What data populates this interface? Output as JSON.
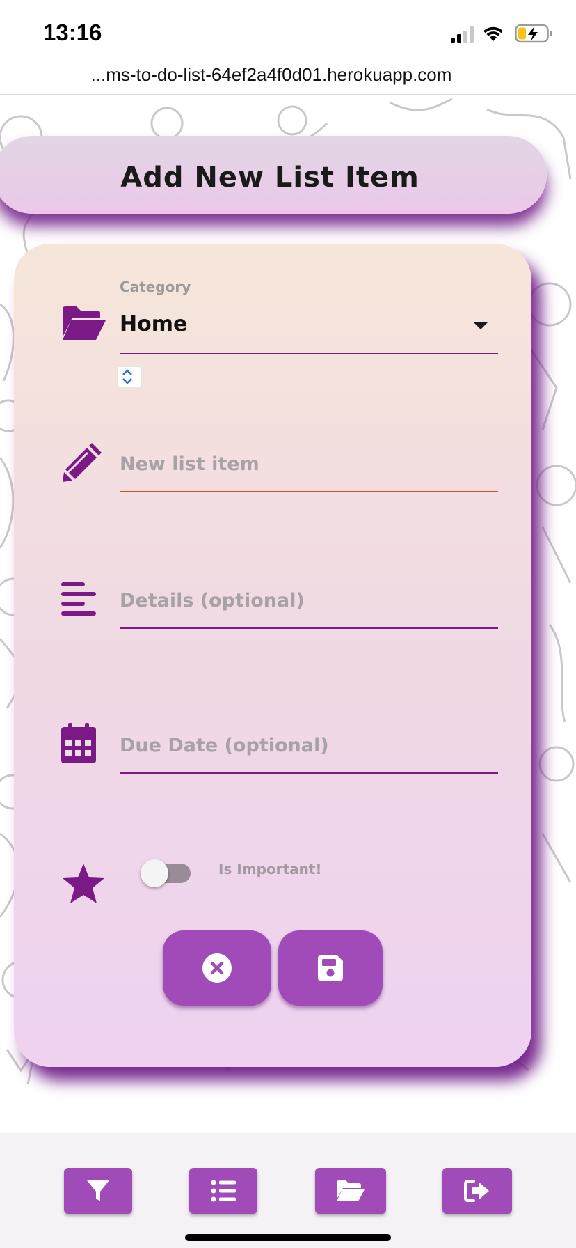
{
  "status_bar": {
    "time": "13:16",
    "icons": [
      "signal-icon",
      "wifi-icon",
      "battery-charging-icon"
    ]
  },
  "browser": {
    "url": "...ms-to-do-list-64ef2a4f0d01.herokuapp.com"
  },
  "header": {
    "title": "Add New List Item"
  },
  "form": {
    "category": {
      "label": "Category",
      "value": "Home",
      "icon": "folder-open-icon"
    },
    "item": {
      "placeholder": "New list item",
      "value": "",
      "icon": "pencil-icon"
    },
    "details": {
      "placeholder": "Details (optional)",
      "value": "",
      "icon": "align-left-icon"
    },
    "due_date": {
      "placeholder": "Due Date (optional)",
      "value": "",
      "icon": "calendar-icon"
    },
    "important": {
      "label": "Is Important!",
      "checked": false,
      "icon": "star-icon"
    },
    "actions": {
      "cancel_icon": "close-circle-icon",
      "save_icon": "floppy-disk-icon"
    }
  },
  "bottom_nav": {
    "items": [
      {
        "icon": "filter-icon"
      },
      {
        "icon": "list-icon"
      },
      {
        "icon": "folder-open-icon"
      },
      {
        "icon": "sign-out-icon"
      }
    ]
  },
  "colors": {
    "accent": "#a14bb8",
    "icon_purple": "#7b1a86",
    "error_underline": "#e2452f",
    "card_top": "#f6e6d9",
    "card_bottom": "#eed2f0"
  }
}
